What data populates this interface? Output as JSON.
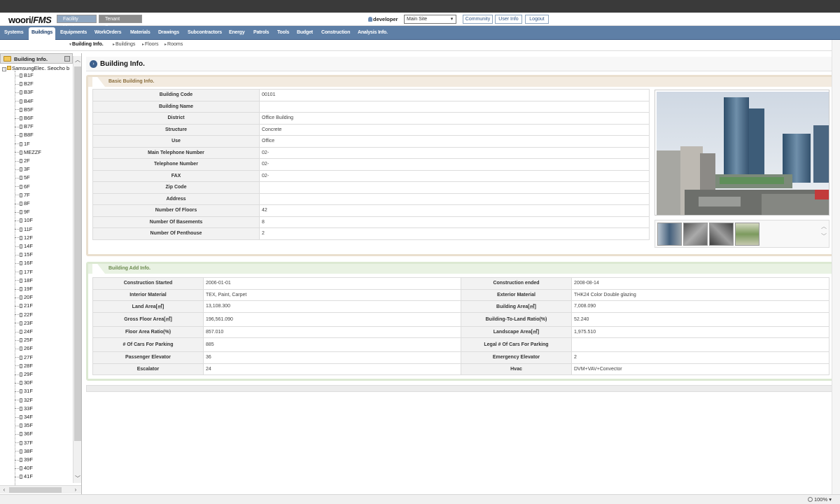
{
  "app": {
    "logo_text": "woori",
    "logo_suffix": "FMS",
    "header_tabs": [
      "Facility Mngt.",
      "Tenant Service"
    ],
    "user": "developer",
    "site_select": "Main Site",
    "header_buttons": [
      "Community",
      "User Info",
      "Logout"
    ]
  },
  "nav": [
    "Systems",
    "Buildings",
    "Equipments",
    "WorkOrders",
    "Materials",
    "Drawings",
    "Subcontractors",
    "Energy",
    "Patrols",
    "Tools",
    "Budget",
    "Construction",
    "Analysis Info."
  ],
  "subnav": [
    "Building Info.",
    "Buildings",
    "Floors",
    "Rooms"
  ],
  "sidebar": {
    "title": "Building Info.",
    "root": "SamsungElec. Seocho b",
    "floors": [
      "B1F",
      "B2F",
      "B3F",
      "B4F",
      "B5F",
      "B6F",
      "B7F",
      "B8F",
      "1F",
      "MEZZF",
      "2F",
      "3F",
      "5F",
      "6F",
      "7F",
      "8F",
      "9F",
      "10F",
      "11F",
      "12F",
      "14F",
      "15F",
      "16F",
      "17F",
      "18F",
      "19F",
      "20F",
      "21F",
      "22F",
      "23F",
      "24F",
      "25F",
      "26F",
      "27F",
      "28F",
      "29F",
      "30F",
      "31F",
      "32F",
      "33F",
      "34F",
      "35F",
      "36F",
      "37F",
      "38F",
      "39F",
      "40F",
      "41F"
    ]
  },
  "page_title": "Building Info.",
  "basic": {
    "title": "Basic Building Info.",
    "rows": [
      {
        "label": "Building Code",
        "value": "00101"
      },
      {
        "label": "Building Name",
        "value": ""
      },
      {
        "label": "District",
        "value": "Office Building"
      },
      {
        "label": "Structure",
        "value": "Concrete"
      },
      {
        "label": "Use",
        "value": "Office"
      },
      {
        "label": "Main Telephone Number",
        "value": "02-"
      },
      {
        "label": "Telephone Number",
        "value": "02-"
      },
      {
        "label": "FAX",
        "value": "02-"
      },
      {
        "label": "Zip Code",
        "value": ""
      },
      {
        "label": "Address",
        "value": ""
      },
      {
        "label": "Number Of Floors",
        "value": "42"
      },
      {
        "label": "Number Of Basements",
        "value": "8"
      },
      {
        "label": "Number Of Penthouse",
        "value": "2"
      }
    ]
  },
  "add": {
    "title": "Building Add Info.",
    "rows": [
      {
        "l1": "Construction Started",
        "v1": "2006-01-01",
        "l2": "Construction ended",
        "v2": "2008-08-14"
      },
      {
        "l1": "Interior Material",
        "v1": "TEX, Paint, Carpet",
        "l2": "Exterior Material",
        "v2": "THK24 Color Double glazing"
      },
      {
        "l1": "Land Area[㎡]",
        "v1": "13,108.300",
        "l2": "Building Area[㎡]",
        "v2": "7,008.090"
      },
      {
        "l1": "Gross Floor Area[㎡]",
        "v1": "196,561.090",
        "l2": "Building-To-Land Ratio(%)",
        "v2": "52.240"
      },
      {
        "l1": "Floor Area Ratio(%)",
        "v1": "857.010",
        "l2": "Landscape Area[㎡]",
        "v2": "1,975.510"
      },
      {
        "l1": "# Of Cars For Parking",
        "v1": "885",
        "l2": "Legal # Of Cars For Parking",
        "v2": ""
      },
      {
        "l1": "Passenger Elevator",
        "v1": "36",
        "l2": "Emergency Elevator",
        "v2": "2"
      },
      {
        "l1": "Escalator",
        "v1": "24",
        "l2": "Hvac",
        "v2": "DVM+VAV+Convector"
      }
    ]
  },
  "status": {
    "zoom": "100%"
  }
}
